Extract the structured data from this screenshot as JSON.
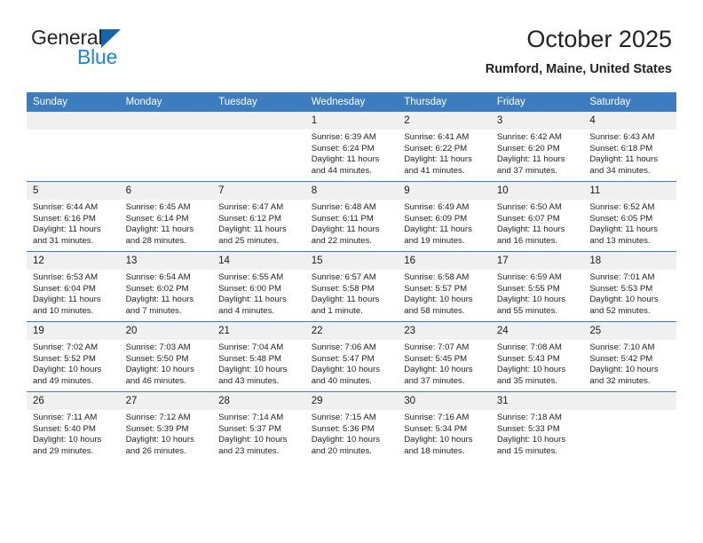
{
  "brand": {
    "line1": "General",
    "line2": "Blue",
    "triangle_color": "#1266ac",
    "text_color": "#262626",
    "accent_color": "#2083d5"
  },
  "header": {
    "title": "October 2025",
    "subtitle": "Rumford, Maine, United States"
  },
  "theme": {
    "header_bar_color": "#3d7dbf",
    "daynum_band_color": "#f0f0f0",
    "grid_line_color": "#3d7dbf",
    "page_background": "#ffffff",
    "text_color": "#1f1f1f"
  },
  "weekday_headers": [
    "Sunday",
    "Monday",
    "Tuesday",
    "Wednesday",
    "Thursday",
    "Friday",
    "Saturday"
  ],
  "labels": {
    "sunrise_prefix": "Sunrise:",
    "sunset_prefix": "Sunset:",
    "daylight_prefix": "Daylight:"
  },
  "weeks": [
    [
      {
        "blank": true
      },
      {
        "blank": true
      },
      {
        "blank": true
      },
      {
        "blank": false,
        "day": "1",
        "sunrise": "Sunrise: 6:39 AM",
        "sunset": "Sunset: 6:24 PM",
        "daylight": "Daylight: 11 hours and 44 minutes."
      },
      {
        "blank": false,
        "day": "2",
        "sunrise": "Sunrise: 6:41 AM",
        "sunset": "Sunset: 6:22 PM",
        "daylight": "Daylight: 11 hours and 41 minutes."
      },
      {
        "blank": false,
        "day": "3",
        "sunrise": "Sunrise: 6:42 AM",
        "sunset": "Sunset: 6:20 PM",
        "daylight": "Daylight: 11 hours and 37 minutes."
      },
      {
        "blank": false,
        "day": "4",
        "sunrise": "Sunrise: 6:43 AM",
        "sunset": "Sunset: 6:18 PM",
        "daylight": "Daylight: 11 hours and 34 minutes."
      }
    ],
    [
      {
        "blank": false,
        "day": "5",
        "sunrise": "Sunrise: 6:44 AM",
        "sunset": "Sunset: 6:16 PM",
        "daylight": "Daylight: 11 hours and 31 minutes."
      },
      {
        "blank": false,
        "day": "6",
        "sunrise": "Sunrise: 6:45 AM",
        "sunset": "Sunset: 6:14 PM",
        "daylight": "Daylight: 11 hours and 28 minutes."
      },
      {
        "blank": false,
        "day": "7",
        "sunrise": "Sunrise: 6:47 AM",
        "sunset": "Sunset: 6:12 PM",
        "daylight": "Daylight: 11 hours and 25 minutes."
      },
      {
        "blank": false,
        "day": "8",
        "sunrise": "Sunrise: 6:48 AM",
        "sunset": "Sunset: 6:11 PM",
        "daylight": "Daylight: 11 hours and 22 minutes."
      },
      {
        "blank": false,
        "day": "9",
        "sunrise": "Sunrise: 6:49 AM",
        "sunset": "Sunset: 6:09 PM",
        "daylight": "Daylight: 11 hours and 19 minutes."
      },
      {
        "blank": false,
        "day": "10",
        "sunrise": "Sunrise: 6:50 AM",
        "sunset": "Sunset: 6:07 PM",
        "daylight": "Daylight: 11 hours and 16 minutes."
      },
      {
        "blank": false,
        "day": "11",
        "sunrise": "Sunrise: 6:52 AM",
        "sunset": "Sunset: 6:05 PM",
        "daylight": "Daylight: 11 hours and 13 minutes."
      }
    ],
    [
      {
        "blank": false,
        "day": "12",
        "sunrise": "Sunrise: 6:53 AM",
        "sunset": "Sunset: 6:04 PM",
        "daylight": "Daylight: 11 hours and 10 minutes."
      },
      {
        "blank": false,
        "day": "13",
        "sunrise": "Sunrise: 6:54 AM",
        "sunset": "Sunset: 6:02 PM",
        "daylight": "Daylight: 11 hours and 7 minutes."
      },
      {
        "blank": false,
        "day": "14",
        "sunrise": "Sunrise: 6:55 AM",
        "sunset": "Sunset: 6:00 PM",
        "daylight": "Daylight: 11 hours and 4 minutes."
      },
      {
        "blank": false,
        "day": "15",
        "sunrise": "Sunrise: 6:57 AM",
        "sunset": "Sunset: 5:58 PM",
        "daylight": "Daylight: 11 hours and 1 minute."
      },
      {
        "blank": false,
        "day": "16",
        "sunrise": "Sunrise: 6:58 AM",
        "sunset": "Sunset: 5:57 PM",
        "daylight": "Daylight: 10 hours and 58 minutes."
      },
      {
        "blank": false,
        "day": "17",
        "sunrise": "Sunrise: 6:59 AM",
        "sunset": "Sunset: 5:55 PM",
        "daylight": "Daylight: 10 hours and 55 minutes."
      },
      {
        "blank": false,
        "day": "18",
        "sunrise": "Sunrise: 7:01 AM",
        "sunset": "Sunset: 5:53 PM",
        "daylight": "Daylight: 10 hours and 52 minutes."
      }
    ],
    [
      {
        "blank": false,
        "day": "19",
        "sunrise": "Sunrise: 7:02 AM",
        "sunset": "Sunset: 5:52 PM",
        "daylight": "Daylight: 10 hours and 49 minutes."
      },
      {
        "blank": false,
        "day": "20",
        "sunrise": "Sunrise: 7:03 AM",
        "sunset": "Sunset: 5:50 PM",
        "daylight": "Daylight: 10 hours and 46 minutes."
      },
      {
        "blank": false,
        "day": "21",
        "sunrise": "Sunrise: 7:04 AM",
        "sunset": "Sunset: 5:48 PM",
        "daylight": "Daylight: 10 hours and 43 minutes."
      },
      {
        "blank": false,
        "day": "22",
        "sunrise": "Sunrise: 7:06 AM",
        "sunset": "Sunset: 5:47 PM",
        "daylight": "Daylight: 10 hours and 40 minutes."
      },
      {
        "blank": false,
        "day": "23",
        "sunrise": "Sunrise: 7:07 AM",
        "sunset": "Sunset: 5:45 PM",
        "daylight": "Daylight: 10 hours and 37 minutes."
      },
      {
        "blank": false,
        "day": "24",
        "sunrise": "Sunrise: 7:08 AM",
        "sunset": "Sunset: 5:43 PM",
        "daylight": "Daylight: 10 hours and 35 minutes."
      },
      {
        "blank": false,
        "day": "25",
        "sunrise": "Sunrise: 7:10 AM",
        "sunset": "Sunset: 5:42 PM",
        "daylight": "Daylight: 10 hours and 32 minutes."
      }
    ],
    [
      {
        "blank": false,
        "day": "26",
        "sunrise": "Sunrise: 7:11 AM",
        "sunset": "Sunset: 5:40 PM",
        "daylight": "Daylight: 10 hours and 29 minutes."
      },
      {
        "blank": false,
        "day": "27",
        "sunrise": "Sunrise: 7:12 AM",
        "sunset": "Sunset: 5:39 PM",
        "daylight": "Daylight: 10 hours and 26 minutes."
      },
      {
        "blank": false,
        "day": "28",
        "sunrise": "Sunrise: 7:14 AM",
        "sunset": "Sunset: 5:37 PM",
        "daylight": "Daylight: 10 hours and 23 minutes."
      },
      {
        "blank": false,
        "day": "29",
        "sunrise": "Sunrise: 7:15 AM",
        "sunset": "Sunset: 5:36 PM",
        "daylight": "Daylight: 10 hours and 20 minutes."
      },
      {
        "blank": false,
        "day": "30",
        "sunrise": "Sunrise: 7:16 AM",
        "sunset": "Sunset: 5:34 PM",
        "daylight": "Daylight: 10 hours and 18 minutes."
      },
      {
        "blank": false,
        "day": "31",
        "sunrise": "Sunrise: 7:18 AM",
        "sunset": "Sunset: 5:33 PM",
        "daylight": "Daylight: 10 hours and 15 minutes."
      },
      {
        "blank": true
      }
    ]
  ]
}
